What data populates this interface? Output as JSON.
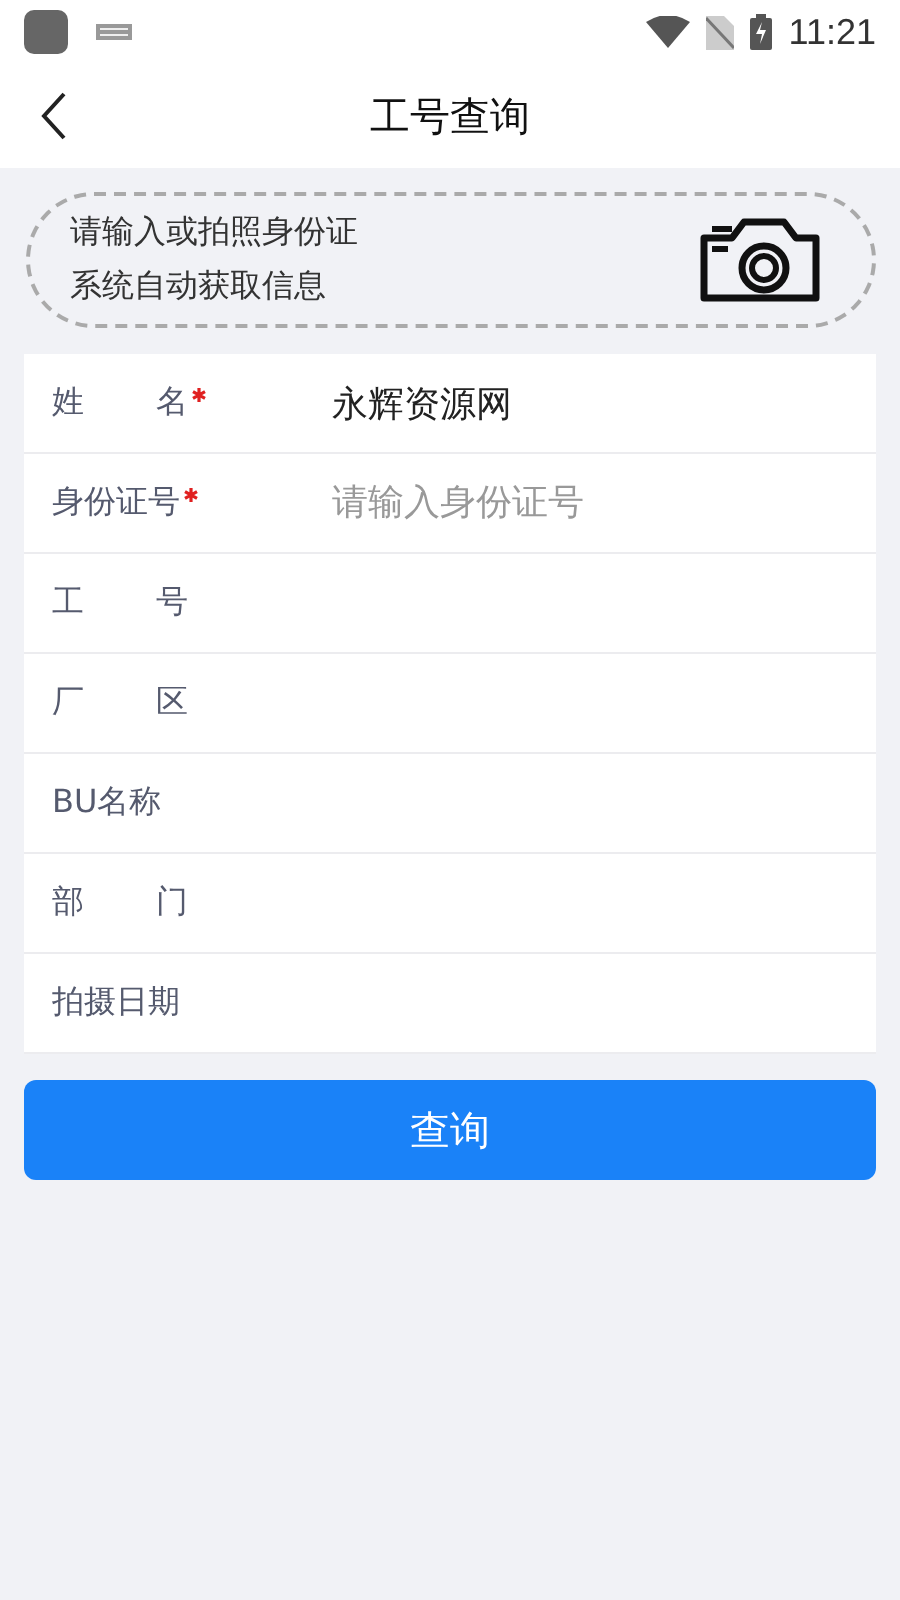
{
  "status_bar": {
    "time": "11:21"
  },
  "header": {
    "title": "工号查询"
  },
  "scan_box": {
    "lines": [
      "请输入或拍照身份证",
      "系统自动获取信息"
    ]
  },
  "fields": [
    {
      "label": "姓 名",
      "kind": "spaced",
      "required": true,
      "value": "永辉资源网"
    },
    {
      "label": "身份证号",
      "kind": "plain",
      "required": true,
      "placeholder": "请输入身份证号"
    },
    {
      "label": "工 号",
      "kind": "spaced",
      "required": false
    },
    {
      "label": "厂 区",
      "kind": "spaced",
      "required": false
    },
    {
      "label": "BU名称",
      "kind": "plain",
      "required": false
    },
    {
      "label": "部 门",
      "kind": "spaced",
      "required": false
    },
    {
      "label": "拍摄日期",
      "kind": "plain",
      "required": false
    }
  ],
  "submit_button": "查询"
}
